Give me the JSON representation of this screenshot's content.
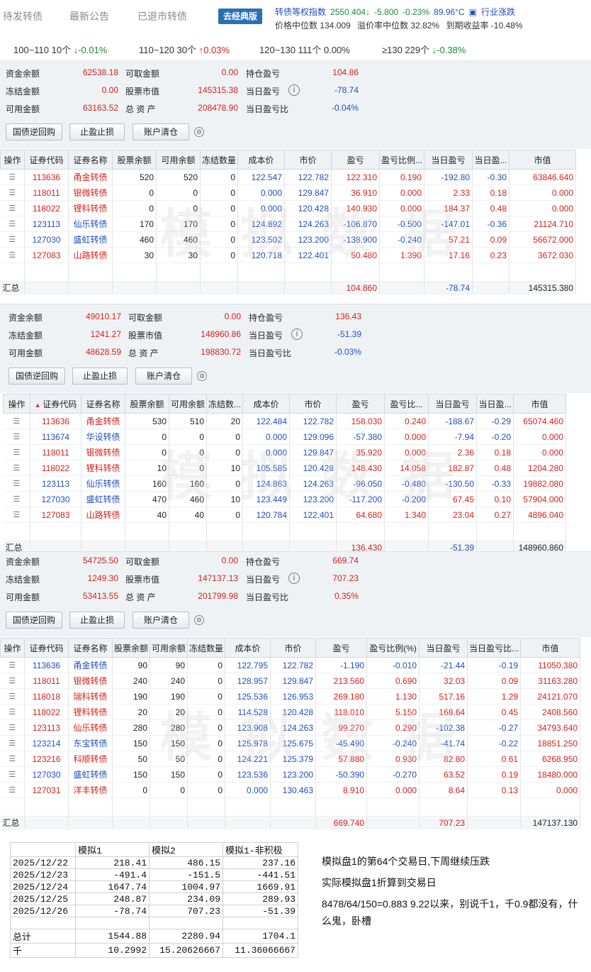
{
  "nav": {
    "tabs": [
      "待发转债",
      "最新公告",
      "已退市转债"
    ],
    "version_button": "去经典版",
    "index_label": "转债等权指数",
    "index_value": "2550.404↓",
    "index_change": "-5.800",
    "index_pct": "-0.23%",
    "temperature": "89.96°C",
    "industry_link": "行业涨跌",
    "median_price": "价格中位数 134.009",
    "median_premium": "溢价率中位数 32.82%",
    "ytm": "到期收益率 -10.48%"
  },
  "distribution": [
    {
      "label": "100~110 10个",
      "arrow": "↓",
      "pct": "-0.01%",
      "color": "#1a8a3a"
    },
    {
      "label": "110~120 30个",
      "arrow": "↑",
      "pct": "0.03%",
      "color": "#d6221a"
    },
    {
      "label": "120~130 111个",
      "arrow": "",
      "pct": "0.00%",
      "color": "#333333"
    },
    {
      "label": "≥130 229个",
      "arrow": "↓",
      "pct": "-0.38%",
      "color": "#1a8a3a"
    }
  ],
  "labels": {
    "cash": "资金余额",
    "withdrawable": "可取金额",
    "pos_pl": "持仓盈亏",
    "frozen": "冻结金额",
    "stock_value": "股票市值",
    "day_pl": "当日盈亏",
    "available": "可用金额",
    "total_assets": "总 资 产",
    "day_pl_ratio": "当日盈亏比",
    "btn_repo": "国债逆回购",
    "btn_stop": "止盈止损",
    "btn_clear": "账户清仓",
    "summary": "汇总",
    "watermark": "模拟数据"
  },
  "headers1": [
    "操作",
    "证券代码",
    "证券名称",
    "股票余额",
    "可用余额",
    "冻结数量",
    "成本价",
    "市价",
    "盈亏",
    "盈亏比例...",
    "当日盈亏",
    "当日盈...",
    "市值"
  ],
  "headers2": [
    "操作",
    "证券代码",
    "证券名称",
    "股票余额",
    "可用余额",
    "冻结数...",
    "成本价",
    "市价",
    "盈亏",
    "盈亏比...",
    "当日盈亏",
    "当日盈...",
    "市值"
  ],
  "headers3": [
    "操作",
    "证券代码",
    "证券名称",
    "股票余额",
    "可用余额",
    "冻结数量",
    "成本价",
    "市价",
    "盈亏",
    "盈亏比例(%)",
    "当日盈亏",
    "当日盈亏比...",
    "市值"
  ],
  "account1": {
    "cash": "62538.18",
    "withdrawable": "0.00",
    "pos_pl": "104.86",
    "frozen": "0.00",
    "stock_value": "145315.38",
    "day_pl": "-78.74",
    "available": "63163.52",
    "total_assets": "208478.90",
    "day_pl_ratio": "-0.04%",
    "rows": [
      [
        "113636",
        "甬金转债",
        "520",
        "520",
        "0",
        "122.547",
        "122.782",
        "122.310",
        "0.190",
        "-192.80",
        "-0.30",
        "63846.640"
      ],
      [
        "118011",
        "银微转债",
        "0",
        "0",
        "0",
        "0.000",
        "129.847",
        "36.910",
        "0.000",
        "2.33",
        "0.18",
        "0.000"
      ],
      [
        "118022",
        "锂科转债",
        "0",
        "0",
        "0",
        "0.000",
        "120.428",
        "140.930",
        "0.000",
        "184.37",
        "0.48",
        "0.000"
      ],
      [
        "123113",
        "仙乐转债",
        "170",
        "170",
        "0",
        "124.892",
        "124.263",
        "-106.870",
        "-0.500",
        "-147.01",
        "-0.36",
        "21124.710"
      ],
      [
        "127030",
        "盛虹转债",
        "460",
        "460",
        "0",
        "123.502",
        "123.200",
        "-138.900",
        "-0.240",
        "57.21",
        "0.09",
        "56672.000"
      ],
      [
        "127083",
        "山路转债",
        "30",
        "30",
        "0",
        "120.718",
        "122.401",
        "50.480",
        "1.390",
        "17.16",
        "0.23",
        "3672.030"
      ]
    ],
    "sum_pl": "104.860",
    "sum_day": "-78.74",
    "sum_value": "145315.380"
  },
  "account2": {
    "cash": "49010.17",
    "withdrawable": "0.00",
    "pos_pl": "136.43",
    "frozen": "1241.27",
    "stock_value": "148960.86",
    "day_pl": "-51.39",
    "available": "48628.59",
    "total_assets": "198830.72",
    "day_pl_ratio": "-0.03%",
    "rows": [
      [
        "113636",
        "甬金转债",
        "530",
        "510",
        "20",
        "122.484",
        "122.782",
        "158.030",
        "0.240",
        "-188.67",
        "-0.29",
        "65074.460"
      ],
      [
        "113674",
        "华设转债",
        "0",
        "0",
        "0",
        "0.000",
        "129.096",
        "-57.380",
        "0.000",
        "-7.94",
        "-0.20",
        "0.000"
      ],
      [
        "118011",
        "银微转债",
        "0",
        "0",
        "0",
        "0.000",
        "129.847",
        "35.920",
        "0.000",
        "2.36",
        "0.18",
        "0.000"
      ],
      [
        "118022",
        "锂科转债",
        "10",
        "0",
        "10",
        "105.585",
        "120.428",
        "148.430",
        "14.058",
        "182.87",
        "0.48",
        "1204.280"
      ],
      [
        "123113",
        "仙乐转债",
        "160",
        "160",
        "0",
        "124.863",
        "124.263",
        "-96.050",
        "-0.480",
        "-130.50",
        "-0.33",
        "19882.080"
      ],
      [
        "127030",
        "盛虹转债",
        "470",
        "460",
        "10",
        "123.449",
        "123.200",
        "-117.200",
        "-0.200",
        "67.45",
        "0.10",
        "57904.000"
      ],
      [
        "127083",
        "山路转债",
        "40",
        "40",
        "0",
        "120.784",
        "122.401",
        "64.680",
        "1.340",
        "23.04",
        "0.27",
        "4896.040"
      ]
    ],
    "sum_pl": "136.430",
    "sum_day": "-51.39",
    "sum_value": "148960.860"
  },
  "account3": {
    "cash": "54725.50",
    "withdrawable": "0.00",
    "pos_pl": "669.74",
    "frozen": "1249.30",
    "stock_value": "147137.13",
    "day_pl": "707.23",
    "available": "53413.55",
    "total_assets": "201799.98",
    "day_pl_ratio": "0.35%",
    "rows": [
      [
        "113636",
        "甬金转债",
        "90",
        "90",
        "0",
        "122.795",
        "122.782",
        "-1.190",
        "-0.010",
        "-21.44",
        "-0.19",
        "11050.380"
      ],
      [
        "118011",
        "银微转债",
        "240",
        "240",
        "0",
        "128.957",
        "129.847",
        "213.560",
        "0.690",
        "32.03",
        "0.09",
        "31163.280"
      ],
      [
        "118018",
        "瑞科转债",
        "190",
        "190",
        "0",
        "125.536",
        "126.953",
        "269.180",
        "1.130",
        "517.16",
        "1.29",
        "24121.070"
      ],
      [
        "118022",
        "锂科转债",
        "20",
        "20",
        "0",
        "114.528",
        "120.428",
        "118.010",
        "5.150",
        "168.64",
        "0.45",
        "2408.560"
      ],
      [
        "123113",
        "仙乐转债",
        "280",
        "280",
        "0",
        "123.908",
        "124.263",
        "99.270",
        "0.290",
        "-102.38",
        "-0.27",
        "34793.640"
      ],
      [
        "123214",
        "东宝转债",
        "150",
        "150",
        "0",
        "125.978",
        "125.675",
        "-45.490",
        "-0.240",
        "-41.74",
        "-0.22",
        "18851.250"
      ],
      [
        "123216",
        "科顺转债",
        "50",
        "50",
        "0",
        "124.221",
        "125.379",
        "57.880",
        "0.930",
        "82.80",
        "0.61",
        "6268.950"
      ],
      [
        "127030",
        "盛虹转债",
        "150",
        "150",
        "0",
        "123.536",
        "123.200",
        "-50.390",
        "-0.270",
        "63.52",
        "0.19",
        "18480.000"
      ],
      [
        "127031",
        "洋丰转债",
        "0",
        "0",
        "0",
        "0.000",
        "130.463",
        "8.910",
        "0.000",
        "8.64",
        "0.13",
        "0.000"
      ]
    ],
    "sum_pl": "669.740",
    "sum_day": "707.23",
    "sum_value": "147137.130"
  },
  "sheet": {
    "header": [
      "",
      "模拟1",
      "模拟2",
      "模拟1-非积极"
    ],
    "rows": [
      [
        "2025/12/22",
        "218.41",
        "486.15",
        "237.16"
      ],
      [
        "2025/12/23",
        "-491.4",
        "-151.5",
        "-441.51"
      ],
      [
        "2025/12/24",
        "1647.74",
        "1004.97",
        "1669.91"
      ],
      [
        "2025/12/25",
        "248.87",
        "234.09",
        "289.93"
      ],
      [
        "2025/12/26",
        "-78.74",
        "707.23",
        "-51.39"
      ],
      [
        "",
        "",
        "",
        ""
      ],
      [
        "总计",
        "1544.88",
        "2280.94",
        "1704.1"
      ],
      [
        "千",
        "10.2992",
        "15.20626667",
        "11.36066667"
      ]
    ]
  },
  "notes": [
    "模拟盘1的第64个交易日,下周继续压跌",
    "实际模拟盘1折算到交易日",
    "8478/64/150=0.883  9.22以来，别说千1，千0.9都没有，什么鬼，卧槽"
  ]
}
